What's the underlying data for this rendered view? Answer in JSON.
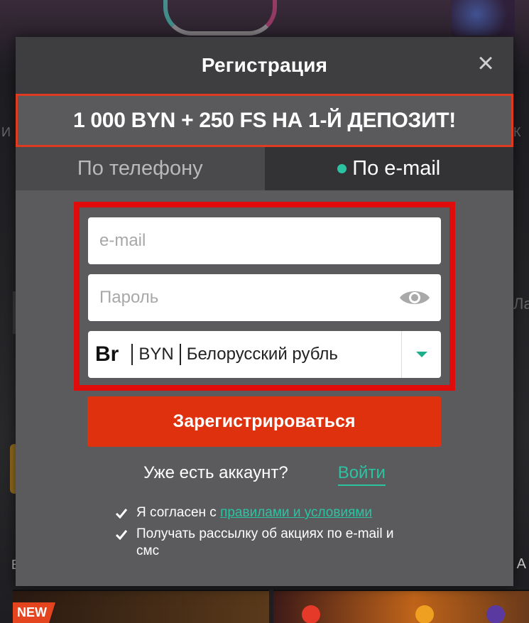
{
  "modal": {
    "title": "Регистрация",
    "promo": "1 000 BYN + 250 FS НА 1-Й ДЕПОЗИТ!"
  },
  "tabs": [
    {
      "label": "По телефону",
      "active": false
    },
    {
      "label": "По e-mail",
      "active": true
    }
  ],
  "form": {
    "email_placeholder": "e-mail",
    "password_placeholder": "Пароль",
    "currency": {
      "symbol": "Br",
      "code": "BYN",
      "name": "Белорусский рубль"
    },
    "submit_label": "Зарегистрироваться"
  },
  "login": {
    "prompt": "Уже есть аккаунт?",
    "link": "Войти"
  },
  "consents": {
    "terms_prefix": "Я согласен с",
    "terms_link": "правилами и условиями",
    "newsletter": "Получать рассылку об акциях по e-mail и смс"
  },
  "background": {
    "badge": "NEW",
    "left_edge": "И",
    "right_edge": "К",
    "right_edge2": "Ла",
    "left_letter": "В",
    "right_letter": "А"
  },
  "colors": {
    "accent": "#2bc4a3",
    "cta": "#e0310f",
    "highlight_frame": "#e00b0b",
    "promo_border": "#e03a20"
  },
  "icons": {
    "close": "close-icon",
    "eye": "eye-icon",
    "dropdown": "chevron-down-icon",
    "check": "checkmark-icon",
    "dot": "active-dot-icon"
  }
}
